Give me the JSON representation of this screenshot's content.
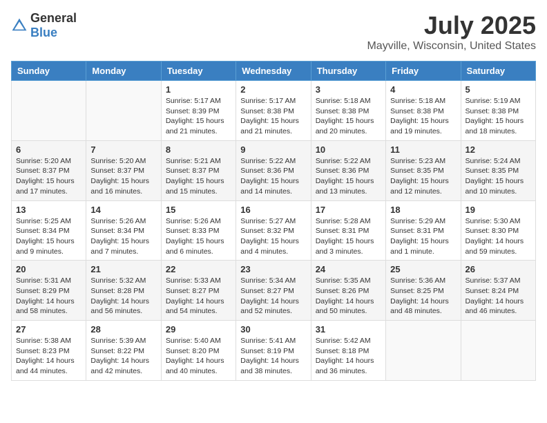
{
  "header": {
    "logo_general": "General",
    "logo_blue": "Blue",
    "title": "July 2025",
    "location": "Mayville, Wisconsin, United States"
  },
  "days_of_week": [
    "Sunday",
    "Monday",
    "Tuesday",
    "Wednesday",
    "Thursday",
    "Friday",
    "Saturday"
  ],
  "weeks": [
    [
      {
        "day": "",
        "info": ""
      },
      {
        "day": "",
        "info": ""
      },
      {
        "day": "1",
        "info": "Sunrise: 5:17 AM\nSunset: 8:39 PM\nDaylight: 15 hours\nand 21 minutes."
      },
      {
        "day": "2",
        "info": "Sunrise: 5:17 AM\nSunset: 8:38 PM\nDaylight: 15 hours\nand 21 minutes."
      },
      {
        "day": "3",
        "info": "Sunrise: 5:18 AM\nSunset: 8:38 PM\nDaylight: 15 hours\nand 20 minutes."
      },
      {
        "day": "4",
        "info": "Sunrise: 5:18 AM\nSunset: 8:38 PM\nDaylight: 15 hours\nand 19 minutes."
      },
      {
        "day": "5",
        "info": "Sunrise: 5:19 AM\nSunset: 8:38 PM\nDaylight: 15 hours\nand 18 minutes."
      }
    ],
    [
      {
        "day": "6",
        "info": "Sunrise: 5:20 AM\nSunset: 8:37 PM\nDaylight: 15 hours\nand 17 minutes."
      },
      {
        "day": "7",
        "info": "Sunrise: 5:20 AM\nSunset: 8:37 PM\nDaylight: 15 hours\nand 16 minutes."
      },
      {
        "day": "8",
        "info": "Sunrise: 5:21 AM\nSunset: 8:37 PM\nDaylight: 15 hours\nand 15 minutes."
      },
      {
        "day": "9",
        "info": "Sunrise: 5:22 AM\nSunset: 8:36 PM\nDaylight: 15 hours\nand 14 minutes."
      },
      {
        "day": "10",
        "info": "Sunrise: 5:22 AM\nSunset: 8:36 PM\nDaylight: 15 hours\nand 13 minutes."
      },
      {
        "day": "11",
        "info": "Sunrise: 5:23 AM\nSunset: 8:35 PM\nDaylight: 15 hours\nand 12 minutes."
      },
      {
        "day": "12",
        "info": "Sunrise: 5:24 AM\nSunset: 8:35 PM\nDaylight: 15 hours\nand 10 minutes."
      }
    ],
    [
      {
        "day": "13",
        "info": "Sunrise: 5:25 AM\nSunset: 8:34 PM\nDaylight: 15 hours\nand 9 minutes."
      },
      {
        "day": "14",
        "info": "Sunrise: 5:26 AM\nSunset: 8:34 PM\nDaylight: 15 hours\nand 7 minutes."
      },
      {
        "day": "15",
        "info": "Sunrise: 5:26 AM\nSunset: 8:33 PM\nDaylight: 15 hours\nand 6 minutes."
      },
      {
        "day": "16",
        "info": "Sunrise: 5:27 AM\nSunset: 8:32 PM\nDaylight: 15 hours\nand 4 minutes."
      },
      {
        "day": "17",
        "info": "Sunrise: 5:28 AM\nSunset: 8:31 PM\nDaylight: 15 hours\nand 3 minutes."
      },
      {
        "day": "18",
        "info": "Sunrise: 5:29 AM\nSunset: 8:31 PM\nDaylight: 15 hours\nand 1 minute."
      },
      {
        "day": "19",
        "info": "Sunrise: 5:30 AM\nSunset: 8:30 PM\nDaylight: 14 hours\nand 59 minutes."
      }
    ],
    [
      {
        "day": "20",
        "info": "Sunrise: 5:31 AM\nSunset: 8:29 PM\nDaylight: 14 hours\nand 58 minutes."
      },
      {
        "day": "21",
        "info": "Sunrise: 5:32 AM\nSunset: 8:28 PM\nDaylight: 14 hours\nand 56 minutes."
      },
      {
        "day": "22",
        "info": "Sunrise: 5:33 AM\nSunset: 8:27 PM\nDaylight: 14 hours\nand 54 minutes."
      },
      {
        "day": "23",
        "info": "Sunrise: 5:34 AM\nSunset: 8:27 PM\nDaylight: 14 hours\nand 52 minutes."
      },
      {
        "day": "24",
        "info": "Sunrise: 5:35 AM\nSunset: 8:26 PM\nDaylight: 14 hours\nand 50 minutes."
      },
      {
        "day": "25",
        "info": "Sunrise: 5:36 AM\nSunset: 8:25 PM\nDaylight: 14 hours\nand 48 minutes."
      },
      {
        "day": "26",
        "info": "Sunrise: 5:37 AM\nSunset: 8:24 PM\nDaylight: 14 hours\nand 46 minutes."
      }
    ],
    [
      {
        "day": "27",
        "info": "Sunrise: 5:38 AM\nSunset: 8:23 PM\nDaylight: 14 hours\nand 44 minutes."
      },
      {
        "day": "28",
        "info": "Sunrise: 5:39 AM\nSunset: 8:22 PM\nDaylight: 14 hours\nand 42 minutes."
      },
      {
        "day": "29",
        "info": "Sunrise: 5:40 AM\nSunset: 8:20 PM\nDaylight: 14 hours\nand 40 minutes."
      },
      {
        "day": "30",
        "info": "Sunrise: 5:41 AM\nSunset: 8:19 PM\nDaylight: 14 hours\nand 38 minutes."
      },
      {
        "day": "31",
        "info": "Sunrise: 5:42 AM\nSunset: 8:18 PM\nDaylight: 14 hours\nand 36 minutes."
      },
      {
        "day": "",
        "info": ""
      },
      {
        "day": "",
        "info": ""
      }
    ]
  ]
}
